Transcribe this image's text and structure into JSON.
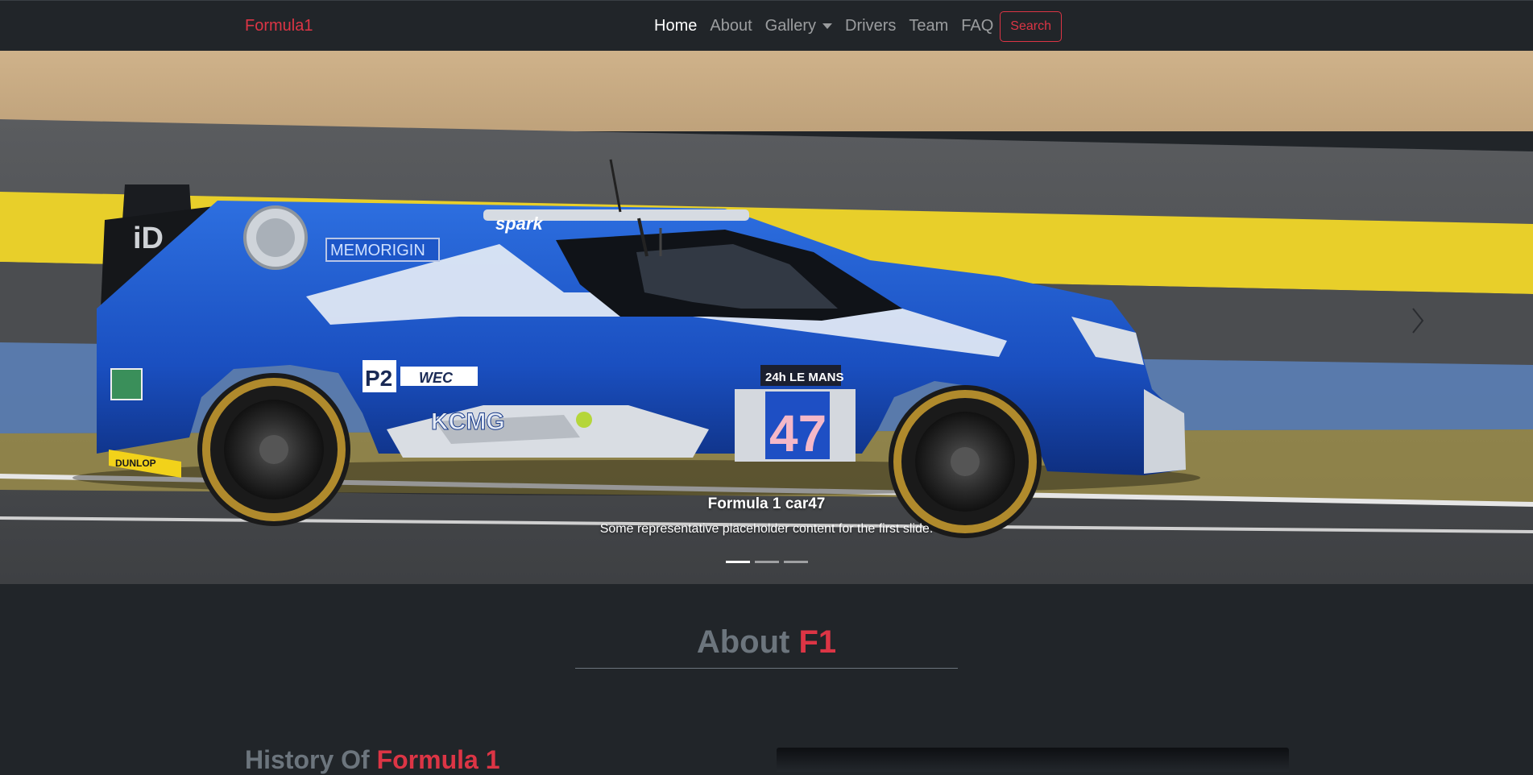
{
  "navbar": {
    "brand": "Formula1",
    "links": [
      {
        "label": "Home"
      },
      {
        "label": "About"
      },
      {
        "label": "Gallery"
      },
      {
        "label": "Drivers"
      },
      {
        "label": "Team"
      },
      {
        "label": "FAQ"
      }
    ],
    "search_label": "Search"
  },
  "carousel": {
    "slides": [
      {
        "title": "Formula 1 car47",
        "text": "Some representative placeholder content for the first slide.",
        "image": "blue-le-mans-prototype-race-car-photo"
      }
    ],
    "indicator_count": 3,
    "active_indicator": 0,
    "car": {
      "number": "47",
      "class_badge": "P2",
      "sponsors": [
        "spark",
        "MEMORIGIN",
        "KCMG",
        "WEC",
        "DUNLOP",
        "24h LE MANS"
      ]
    }
  },
  "about": {
    "heading_prefix": "About",
    "heading_accent": "F1",
    "subheading_prefix": "History Of",
    "subheading_accent": "Formula 1"
  },
  "colors": {
    "background": "#212529",
    "accent": "#dc3545",
    "muted": "#6c757d",
    "car_blue": "#1f5fd6"
  }
}
